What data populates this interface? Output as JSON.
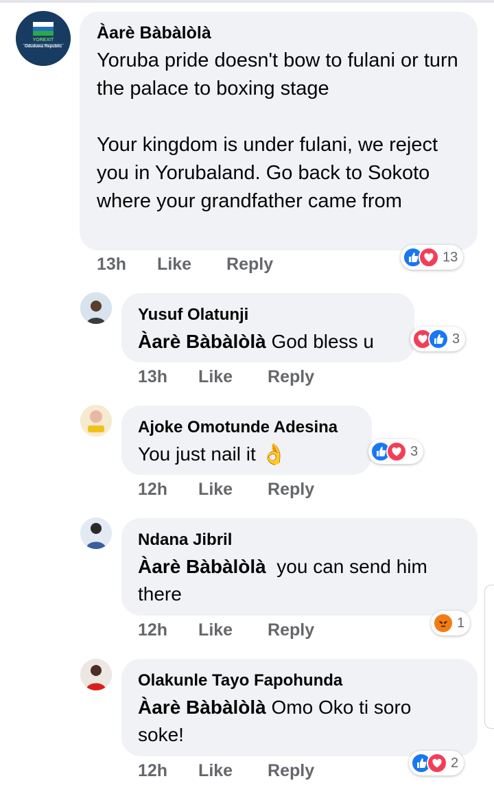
{
  "colors": {
    "bubble": "#f0f2f5",
    "meta": "#65676b",
    "like_blue": "#1877f2",
    "love_red": "#f33e58",
    "angry_orange": "#f27c14"
  },
  "main_comment": {
    "author": "Àarè Bàbàlòlà",
    "avatar_text_1": "YOREXIT",
    "avatar_text_2": "Oduduwa Republic",
    "paragraph_1": "Yoruba pride doesn't bow to fulani or turn the palace to boxing stage",
    "paragraph_2": "Your kingdom is under fulani, we reject you in Yorubaland. Go back to Sokoto where your grandfather came from",
    "time": "13h",
    "like_label": "Like",
    "reply_label": "Reply",
    "reactions": [
      "like-icon",
      "love-icon"
    ],
    "reaction_count": "13"
  },
  "replies": [
    {
      "author": "Yusuf Olatunji",
      "mention": "Àarè Bàbàlòlà",
      "text": " God bless u",
      "time": "13h",
      "like_label": "Like",
      "reply_label": "Reply",
      "reactions": [
        "love-icon",
        "like-icon"
      ],
      "reaction_count": "3"
    },
    {
      "author": "Ajoke Omotunde Adesina",
      "mention": "",
      "text": "You just nail it ",
      "emoji": "👌",
      "time": "12h",
      "like_label": "Like",
      "reply_label": "Reply",
      "reactions": [
        "like-icon",
        "love-icon"
      ],
      "reaction_count": "3"
    },
    {
      "author": "Ndana Jibril",
      "mention": "Àarè Bàbàlòlà",
      "text": "  you can send him there",
      "time": "12h",
      "like_label": "Like",
      "reply_label": "Reply",
      "reactions": [
        "angry-icon"
      ],
      "reaction_count": "1"
    },
    {
      "author": "Olakunle Tayo Fapohunda",
      "mention": "Àarè Bàbàlòlà",
      "text": " Omo Oko ti soro soke!",
      "time": "12h",
      "like_label": "Like",
      "reply_label": "Reply",
      "reactions": [
        "like-icon",
        "love-icon"
      ],
      "reaction_count": "2"
    }
  ]
}
